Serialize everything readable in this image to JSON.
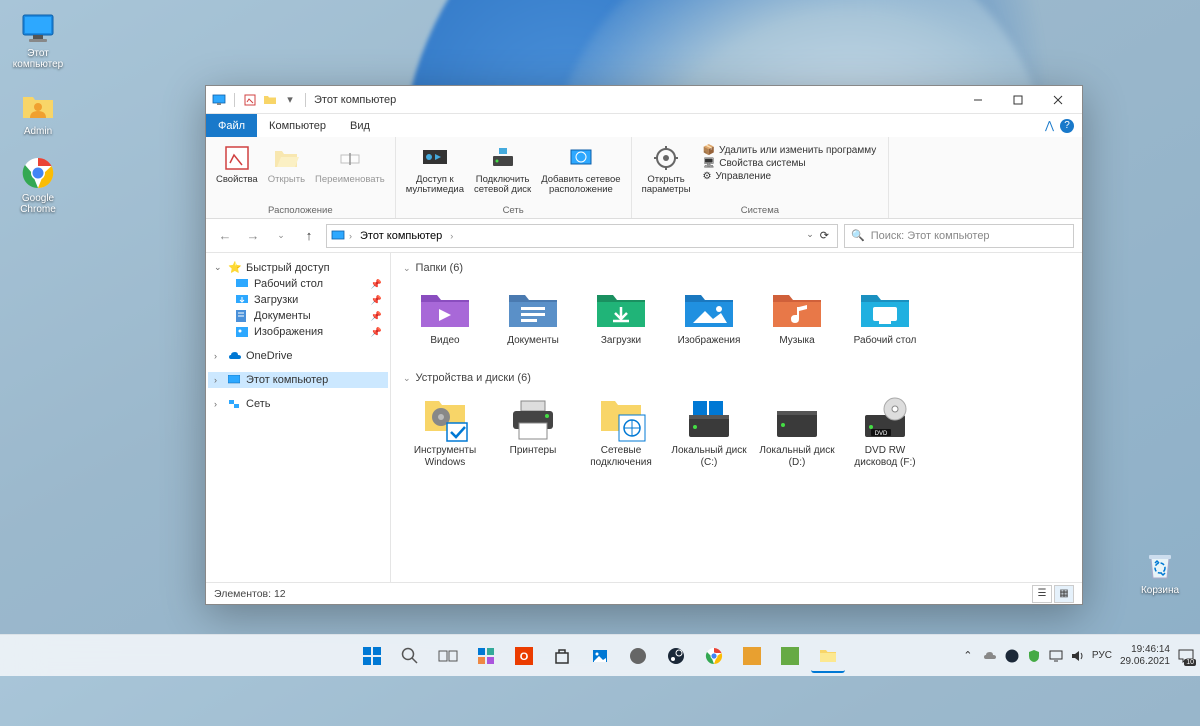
{
  "desktop": {
    "icons": [
      {
        "id": "this-pc",
        "label": "Этот\nкомпьютер"
      },
      {
        "id": "admin",
        "label": "Admin"
      },
      {
        "id": "chrome",
        "label": "Google\nChrome"
      }
    ],
    "recycle_bin_label": "Корзина"
  },
  "explorer": {
    "title": "Этот компьютер",
    "tabs": {
      "file": "Файл",
      "computer": "Компьютер",
      "view": "Вид"
    },
    "ribbon": {
      "group_location": "Расположение",
      "group_network": "Сеть",
      "group_system": "Система",
      "properties": "Свойства",
      "open": "Открыть",
      "rename": "Переименовать",
      "media_access": "Доступ к\nмультимедиа",
      "map_drive": "Подключить\nсетевой диск",
      "add_net_loc": "Добавить сетевое\nрасположение",
      "open_settings": "Открыть\nпараметры",
      "link_uninstall": "Удалить или изменить программу",
      "link_sysprops": "Свойства системы",
      "link_manage": "Управление"
    },
    "breadcrumb": "Этот компьютер",
    "search_placeholder": "Поиск: Этот компьютер",
    "nav": {
      "quick_access": "Быстрый доступ",
      "desktop": "Рабочий стол",
      "downloads": "Загрузки",
      "documents": "Документы",
      "pictures": "Изображения",
      "onedrive": "OneDrive",
      "this_pc": "Этот компьютер",
      "network": "Сеть"
    },
    "sections": {
      "folders_header": "Папки (6)",
      "drives_header": "Устройства и диски (6)"
    },
    "folders": [
      {
        "id": "videos",
        "label": "Видео"
      },
      {
        "id": "documents",
        "label": "Документы"
      },
      {
        "id": "downloads",
        "label": "Загрузки"
      },
      {
        "id": "pictures",
        "label": "Изображения"
      },
      {
        "id": "music",
        "label": "Музыка"
      },
      {
        "id": "desktop",
        "label": "Рабочий стол"
      }
    ],
    "drives": [
      {
        "id": "wintools",
        "label": "Инструменты\nWindows"
      },
      {
        "id": "printers",
        "label": "Принтеры"
      },
      {
        "id": "netconn",
        "label": "Сетевые\nподключения"
      },
      {
        "id": "localc",
        "label": "Локальный диск\n(C:)"
      },
      {
        "id": "locald",
        "label": "Локальный диск\n(D:)"
      },
      {
        "id": "dvd",
        "label": "DVD RW\nдисковод (F:)"
      }
    ],
    "status": "Элементов: 12"
  },
  "taskbar": {
    "lang": "РУС",
    "time": "19:46:14",
    "date": "29.06.2021",
    "notif_count": "10"
  }
}
